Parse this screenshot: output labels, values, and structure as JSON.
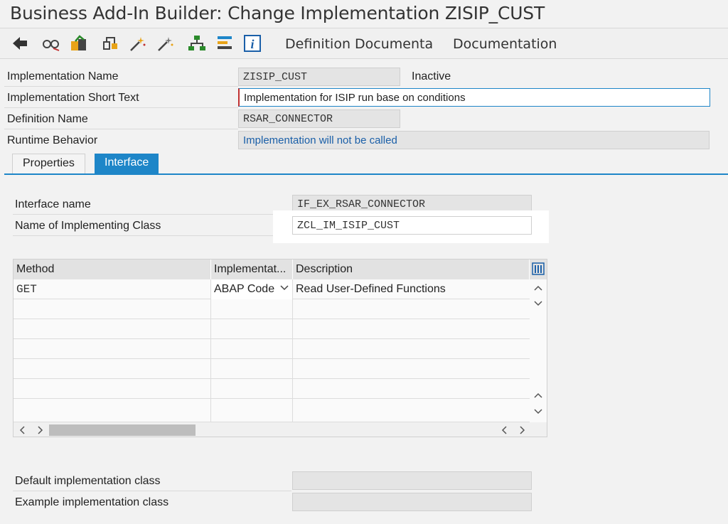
{
  "window": {
    "title": "Business Add-In Builder: Change Implementation ZISIP_CUST"
  },
  "toolbar": {
    "icons": [
      "back-arrow-icon",
      "display-glasses-icon",
      "toggle-change-icon",
      "object-list-icon",
      "activate-wand-icon",
      "deactivate-wand-icon",
      "hierarchy-icon",
      "overview-list-icon",
      "info-icon"
    ],
    "definition_documentation": "Definition Documenta",
    "documentation": "Documentation"
  },
  "header": {
    "impl_name_label": "Implementation Name",
    "impl_name_value": "ZISIP_CUST",
    "status": "Inactive",
    "short_text_label": "Implementation Short Text",
    "short_text_value": "Implementation for ISIP run base on conditions",
    "definition_label": "Definition Name",
    "definition_value": "RSAR_CONNECTOR",
    "runtime_label": "Runtime Behavior",
    "runtime_value": "Implementation will not be called"
  },
  "tabs": [
    {
      "label": "Properties",
      "active": false
    },
    {
      "label": "Interface",
      "active": true
    }
  ],
  "interface": {
    "name_label": "Interface name",
    "name_value": "IF_EX_RSAR_CONNECTOR",
    "class_label": "Name of Implementing Class",
    "class_value": "ZCL_IM_ISIP_CUST"
  },
  "methods_table": {
    "columns": [
      "Method",
      "Implementat...",
      "Description"
    ],
    "rows": [
      {
        "method": "GET",
        "implementation": "ABAP Code",
        "description": "Read User-Defined Functions"
      }
    ]
  },
  "footer": {
    "default_class_label": "Default implementation class",
    "example_class_label": "Example implementation class"
  },
  "colors": {
    "accent": "#1e86c8",
    "link": "#1a5fa8"
  }
}
